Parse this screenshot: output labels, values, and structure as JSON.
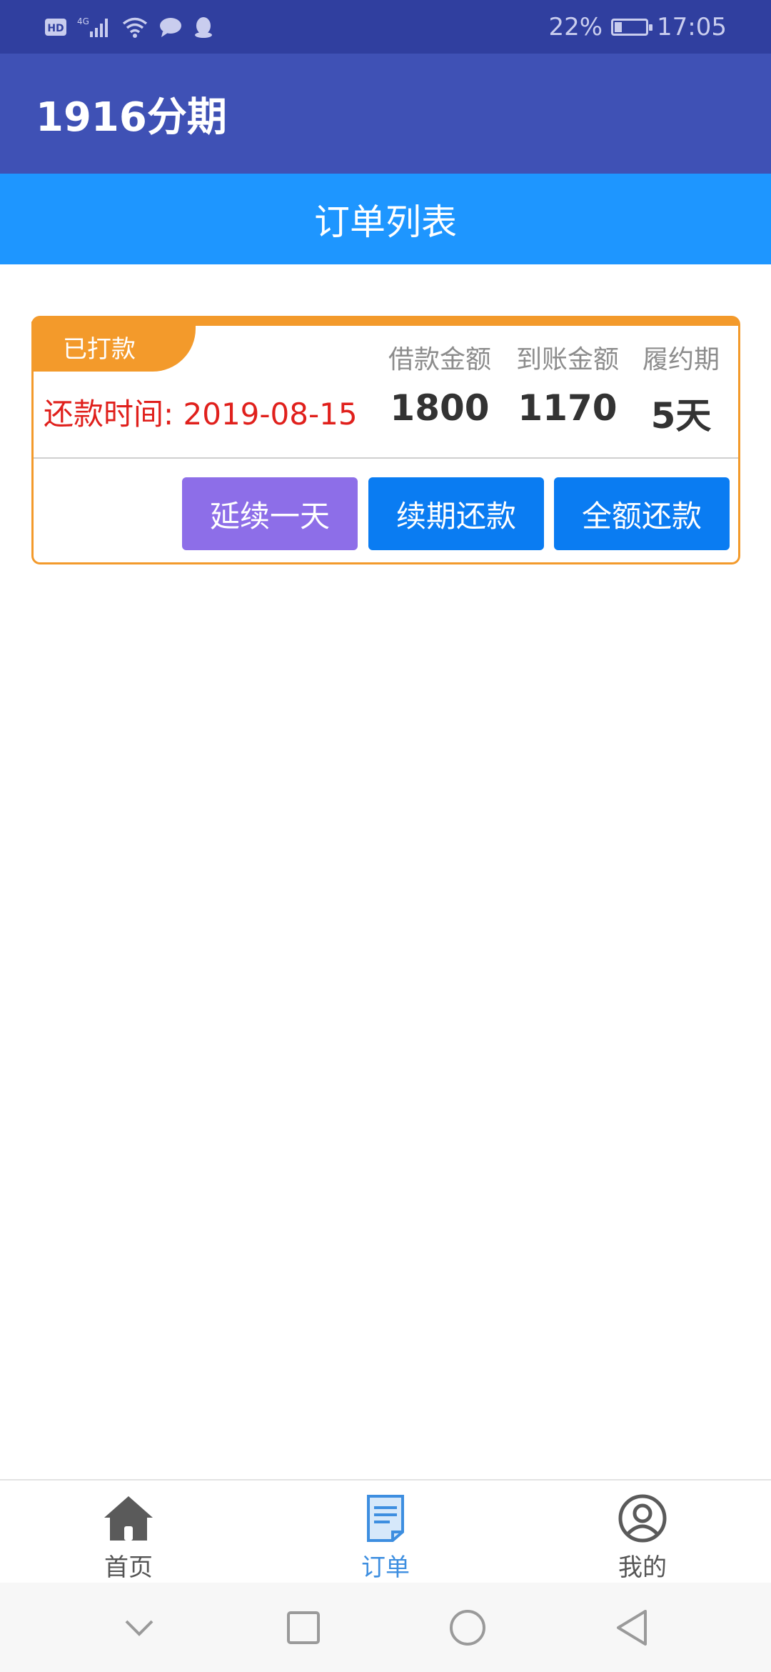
{
  "status_bar": {
    "left_icons": [
      "hd-icon",
      "signal-4g-icon",
      "wifi-icon",
      "message-icon",
      "qq-icon"
    ],
    "battery_percent": "22%",
    "battery_level": 0.22,
    "time": "17:05"
  },
  "app_bar": {
    "title": "1916分期"
  },
  "sub_header": {
    "title": "订单列表"
  },
  "order": {
    "status_tag": "已打款",
    "columns": {
      "loan_amount": "借款金额",
      "received_amount": "到账金额",
      "term": "履约期"
    },
    "repay_label": "还款时间: 2019-08-15",
    "loan_amount": "1800",
    "received_amount": "1170",
    "term": "5天",
    "buttons": {
      "extend": "延续一天",
      "renew": "续期还款",
      "full": "全额还款"
    }
  },
  "bottom_nav": {
    "items": [
      {
        "label": "首页",
        "icon": "home-icon"
      },
      {
        "label": "订单",
        "icon": "order-icon",
        "active": true
      },
      {
        "label": "我的",
        "icon": "profile-icon"
      }
    ]
  },
  "colors": {
    "status_bar": "#303f9f",
    "app_bar": "#3f51b5",
    "sub_header": "#1e96ff",
    "card_accent": "#f39a2b",
    "repay_text": "#e0201c",
    "btn_extend": "#8d6ee8",
    "btn_primary": "#0a7cf2",
    "nav_active": "#3d8ee0"
  }
}
